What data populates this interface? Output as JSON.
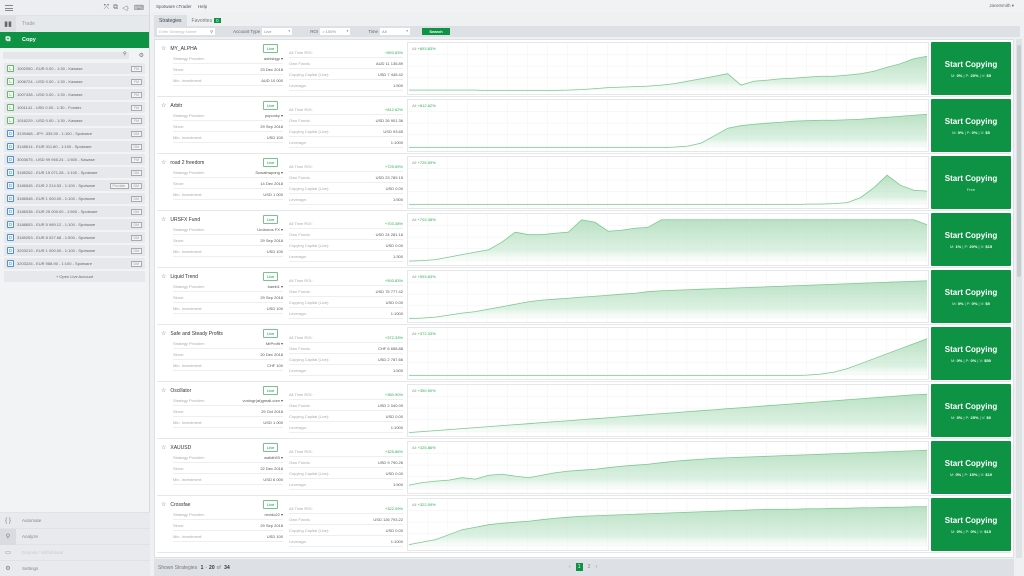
{
  "app": {
    "menu": [
      "Spotware cTrader",
      "Help"
    ],
    "user": "JaneSmith ▾"
  },
  "sidebar": {
    "toolbar_icons": [
      "hamburger-icon",
      "fullscreen-icon",
      "window-icon",
      "sound-icon",
      "keyboard-icon"
    ],
    "nav": [
      {
        "label": "Trade",
        "icon": "trade-icon"
      },
      {
        "label": "Copy",
        "icon": "copy-icon",
        "active": true
      }
    ],
    "accounts": [
      {
        "type": "L",
        "text": "1002050 - EUR 0.00 - 1:30 - Kawase",
        "tags": [
          "FM"
        ]
      },
      {
        "type": "L",
        "text": "1006724 - USD 0.00 - 1:30 - Kawase",
        "tags": [
          "FM"
        ]
      },
      {
        "type": "L",
        "text": "1007438 - USD 0.00 - 1:30 - Kawase",
        "tags": [
          "FM"
        ]
      },
      {
        "type": "L",
        "text": "1001141 - USD 0.00 - 1:30 - Fondex",
        "tags": [
          "FM"
        ]
      },
      {
        "type": "L",
        "text": "1016229 - USD 0.00 - 1:30 - Kawase",
        "tags": [
          "FM"
        ]
      },
      {
        "type": "D",
        "text": "3139468 - JPY -335.00 - 1:100 - Spotware",
        "tags": [
          "DM"
        ]
      },
      {
        "type": "D",
        "text": "3148614 - EUR 311.80 - 1:100 - Spotware",
        "tags": [
          "DM"
        ]
      },
      {
        "type": "D",
        "text": "3003675 - USD 99 955.24 - 1:500 - Kawase",
        "tags": [
          "FM"
        ]
      },
      {
        "type": "D",
        "text": "3185262 - EUR 15 071.28 - 1:100 - Spotware",
        "tags": [
          "DM"
        ]
      },
      {
        "type": "D",
        "text": "3186545 - EUR 2 214.53 - 1:100 - Spotware",
        "tags": [
          "Provider",
          "DM"
        ]
      },
      {
        "type": "D",
        "text": "3186548 - EUR 1 000.00 - 1:100 - Spotware",
        "tags": [
          "DM"
        ]
      },
      {
        "type": "D",
        "text": "3186038 - EUR 25 000.00 - 1:500 - Spotware",
        "tags": [
          "DM"
        ]
      },
      {
        "type": "D",
        "text": "3188653 - EUR 5 989.12 - 1:100 - Spotware",
        "tags": [
          "DM"
        ]
      },
      {
        "type": "D",
        "text": "3189263 - EUR 8 027.68 - 1:500 - Spotware",
        "tags": [
          "DM"
        ]
      },
      {
        "type": "D",
        "text": "3203219 - EUR 1 000.00 - 1:100 - Spotware",
        "tags": [
          "DM"
        ]
      },
      {
        "type": "D",
        "text": "3203226 - EUR 988.90 - 1:100 - Spotware",
        "tags": [
          "DM"
        ]
      }
    ],
    "open_account": "+ Open Live Account",
    "bottom": [
      {
        "label": "Automate",
        "icon": "code-braces-icon"
      },
      {
        "label": "Analyze",
        "icon": "analyze-icon",
        "active": true
      },
      {
        "label": "Deposit / Withdrawal",
        "icon": "wallet-icon",
        "disabled": true
      },
      {
        "label": "Settings",
        "icon": "gear-icon"
      }
    ]
  },
  "tabs": {
    "strategies": "Strategies",
    "favorites": "Favorites",
    "favorites_count": "0"
  },
  "filters": {
    "search_placeholder": "Enter Strategy Name",
    "account_type_label": "Account Type",
    "account_type": "Live",
    "roi_label": "ROI",
    "roi": "> 100%",
    "time_label": "Time",
    "time": "All",
    "search_button": "Search"
  },
  "labels": {
    "provider": "Strategy Provider:",
    "since": "Since:",
    "min_inv": "Min. Investment:",
    "roi": "All Time ROI:",
    "own_funds": "Own Funds:",
    "copy_cap": "Copying Capital (Live):",
    "leverage": "Leverage:",
    "live": "Live",
    "start": "Start Copying",
    "chart_prefix": "All"
  },
  "strategies": [
    {
      "name": "MY_ALPHA",
      "provider": "ashishgp ▾",
      "since": "23 Dec 2018",
      "min_inv": "AUD 10 000",
      "roi": "+893.83%",
      "own_funds": "AUD 11 136.89",
      "copy_cap": "USD 7 445.42",
      "leverage": "1:500",
      "fees": {
        "M": "0%",
        "P": "20%",
        "V": "$5"
      },
      "curve": [
        2,
        2,
        2,
        2,
        2,
        2,
        1,
        1,
        1,
        1,
        1,
        1.5,
        2,
        3,
        5,
        7,
        8,
        9,
        10,
        12,
        15,
        20,
        25,
        30,
        35,
        12,
        20,
        22,
        25,
        26,
        28,
        30,
        30,
        32,
        35,
        40,
        48,
        55,
        65,
        70
      ]
    },
    {
      "name": "Arbitr",
      "provider": "puponky ▾",
      "since": "29 Sep 2018",
      "min_inv": "USD 100",
      "roi": "+812.62%",
      "own_funds": "USD 26 901.36",
      "copy_cap": "USD 93.65",
      "leverage": "1:1000",
      "fees": {
        "M": "0%",
        "P": "0%",
        "V": "$5"
      },
      "curve": [
        1,
        1,
        1,
        1,
        1,
        1,
        1,
        1,
        1,
        1,
        1,
        1,
        1,
        1,
        1,
        1,
        1,
        1,
        1,
        1,
        2,
        4,
        10,
        25,
        40,
        45,
        48,
        50,
        52,
        54,
        55,
        56,
        56,
        57,
        58,
        60,
        62,
        64,
        66,
        68
      ]
    },
    {
      "name": "road 2 freedom",
      "provider": "Suwathapong ▾",
      "since": "14 Dec 2018",
      "min_inv": "USD 1 000",
      "roi": "+725.59%",
      "own_funds": "USD 23 789.15",
      "copy_cap": "USD 0.00",
      "leverage": "1:500",
      "fees_free": "Free",
      "curve": [
        1,
        1,
        1,
        1,
        1,
        1,
        1,
        1,
        1,
        1,
        1,
        1,
        1,
        1,
        1,
        1,
        1,
        1,
        1,
        1,
        1,
        1,
        1,
        1,
        1,
        1,
        1,
        1,
        1,
        1,
        2,
        2,
        3,
        5,
        15,
        35,
        60,
        40,
        30,
        28
      ]
    },
    {
      "name": "URSFX Fund",
      "provider": "Uroboros FX ▾",
      "since": "29 Sep 2018",
      "min_inv": "USD 100",
      "roi": "+703.38%",
      "own_funds": "USD 24 281.16",
      "copy_cap": "USD 0.00",
      "leverage": "1:300",
      "fees": {
        "M": "1%",
        "P": "20%",
        "V": "$15"
      },
      "curve": [
        2,
        3,
        5,
        10,
        15,
        20,
        25,
        40,
        60,
        55,
        55,
        58,
        60,
        85,
        80,
        62,
        64,
        68,
        70,
        85,
        85,
        85,
        85,
        85,
        85,
        85,
        85,
        85,
        85,
        85,
        85,
        85,
        85,
        85,
        85,
        85,
        85,
        85,
        85,
        75
      ]
    },
    {
      "name": "Liquid Trend",
      "provider": "bamb1 ▾",
      "since": "29 Sep 2018",
      "min_inv": "USD 100",
      "roi": "+593.83%",
      "own_funds": "USD 75 777.42",
      "copy_cap": "USD 0.00",
      "leverage": "1:1000",
      "fees": {
        "M": "0%",
        "P": "0%",
        "V": "$5"
      },
      "curve": [
        1,
        2,
        4,
        8,
        12,
        15,
        20,
        25,
        30,
        35,
        38,
        40,
        42,
        44,
        46,
        48,
        50,
        52,
        55,
        57,
        58,
        59,
        60,
        61,
        62,
        63,
        64,
        65,
        66,
        67,
        68,
        69,
        70,
        71,
        72,
        73,
        74,
        75,
        76,
        77
      ]
    },
    {
      "name": "Safe and Steady Profits",
      "provider": "MrProfit ▾",
      "since": "20 Dec 2018",
      "min_inv": "CHF 100",
      "roi": "+372.33%",
      "own_funds": "CHF 6 658.88",
      "copy_cap": "USD 2 787.66",
      "leverage": "1:500",
      "fees": {
        "M": "0%",
        "P": "0%",
        "V": "$50"
      },
      "curve": [
        1,
        1,
        1,
        1,
        1,
        1,
        1,
        1,
        1,
        1,
        1,
        1,
        1,
        1,
        1,
        1,
        1,
        1,
        1,
        1,
        1,
        1,
        1,
        1,
        1,
        1,
        1,
        1,
        1,
        1,
        2,
        4,
        8,
        15,
        25,
        35,
        45,
        55,
        65,
        75
      ]
    },
    {
      "name": "Oscillator",
      "provider": "vonlogr(at)gmail.com ▾",
      "since": "29 Oct 2018",
      "min_inv": "USD 1 000",
      "roi": "+350.90%",
      "own_funds": "USD 2 040.09",
      "copy_cap": "USD 0.00",
      "leverage": "1:1000",
      "fees": {
        "M": "0%",
        "P": "25%",
        "V": "$0"
      },
      "curve": [
        1,
        3,
        5,
        7,
        9,
        11,
        13,
        15,
        17,
        19,
        21,
        23,
        25,
        27,
        29,
        31,
        33,
        35,
        37,
        39,
        41,
        43,
        45,
        47,
        49,
        51,
        53,
        55,
        57,
        59,
        61,
        63,
        65,
        67,
        69,
        71,
        73,
        75,
        77,
        78
      ]
    },
    {
      "name": "XAUUSD",
      "provider": "walidh93 ▾",
      "since": "22 Dec 2018",
      "min_inv": "USD 6 000",
      "roi": "+325.86%",
      "own_funds": "USD 9 790.26",
      "copy_cap": "USD 0.00",
      "leverage": "1:500",
      "fees": {
        "M": "0%",
        "P": "15%",
        "V": "$10"
      },
      "curve": [
        10,
        15,
        18,
        20,
        25,
        22,
        30,
        32,
        28,
        25,
        30,
        35,
        38,
        40,
        42,
        45,
        48,
        50,
        52,
        55,
        58,
        60,
        62,
        64,
        65,
        66,
        67,
        68,
        69,
        70,
        71,
        72,
        73,
        74,
        75,
        76,
        77,
        78,
        79,
        80
      ]
    },
    {
      "name": "Crossfae",
      "provider": "revido22 ▾",
      "since": "29 Sep 2018",
      "min_inv": "USD 100",
      "roi": "+322.09%",
      "own_funds": "USD 126 793.22",
      "copy_cap": "USD 0.00",
      "leverage": "1:1000",
      "fees": {
        "M": "0%",
        "P": "0%",
        "V": "$15"
      },
      "curve": [
        5,
        10,
        15,
        25,
        35,
        40,
        45,
        48,
        50,
        52,
        55,
        58,
        60,
        62,
        63,
        64,
        65,
        66,
        67,
        68,
        69,
        70,
        71,
        72,
        73,
        74,
        75,
        76,
        76,
        76,
        77,
        77,
        78,
        78,
        79,
        79,
        80,
        80,
        81,
        81
      ]
    }
  ],
  "footer": {
    "shown_label": "Shown Strategies",
    "from": "1",
    "to": "20",
    "of_label": "of",
    "total": "34",
    "pages": [
      "1",
      "2"
    ],
    "current_page": "1"
  }
}
